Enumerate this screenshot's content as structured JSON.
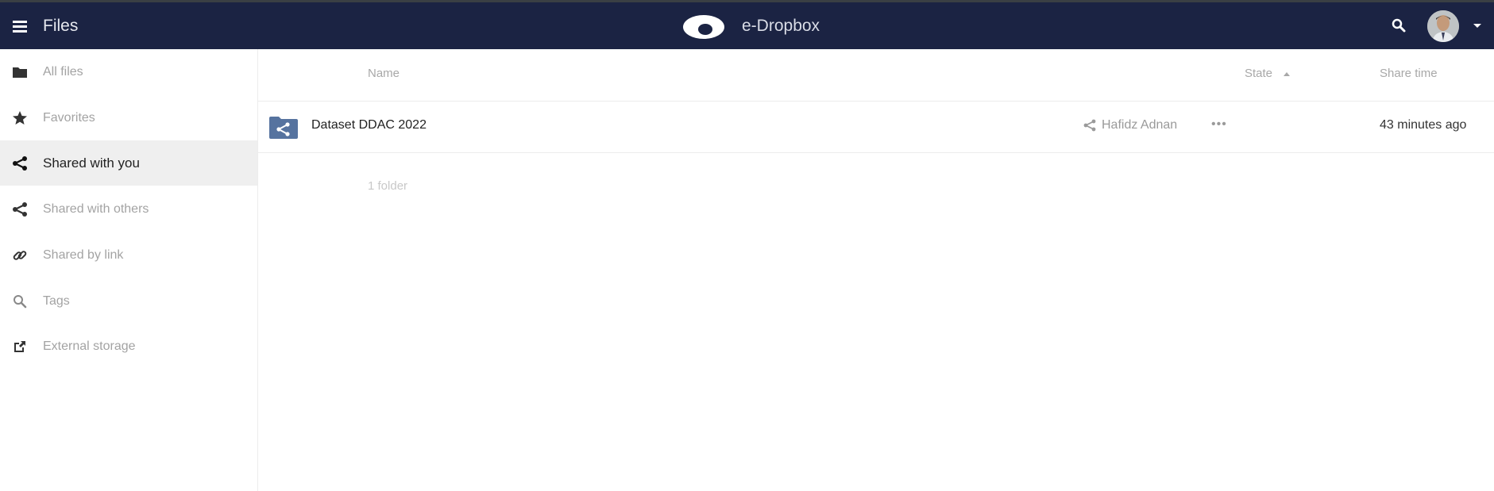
{
  "header": {
    "menu_icon": "hamburger-menu-icon",
    "app_title": "Files",
    "brand_logo": "cloud-logo-icon",
    "brand_name": "e-Dropbox",
    "search_icon": "search-icon",
    "avatar": "user-avatar",
    "avatar_menu_icon": "caret-down-icon",
    "bg_color": "#1b2343"
  },
  "sidebar": {
    "items": [
      {
        "label": "All files",
        "icon": "folder-icon",
        "active": false
      },
      {
        "label": "Favorites",
        "icon": "star-icon",
        "active": false
      },
      {
        "label": "Shared with you",
        "icon": "share-icon",
        "active": true
      },
      {
        "label": "Shared with others",
        "icon": "share-icon",
        "active": false
      },
      {
        "label": "Shared by link",
        "icon": "link-icon",
        "active": false
      },
      {
        "label": "Tags",
        "icon": "search-icon",
        "active": false
      },
      {
        "label": "External storage",
        "icon": "external-link-icon",
        "active": false
      }
    ]
  },
  "table": {
    "columns": {
      "name": "Name",
      "state": "State",
      "share_time": "Share time"
    },
    "rows": [
      {
        "name": "Dataset DDAC 2022",
        "icon": "shared-folder-icon",
        "shared_by": "Hafidz Adnan",
        "more_icon": "more-dots-icon",
        "share_time": "43 minutes ago"
      }
    ],
    "summary": "1 folder"
  },
  "colors": {
    "folder_blue": "#56739f",
    "accent_header": "#1b2343"
  }
}
